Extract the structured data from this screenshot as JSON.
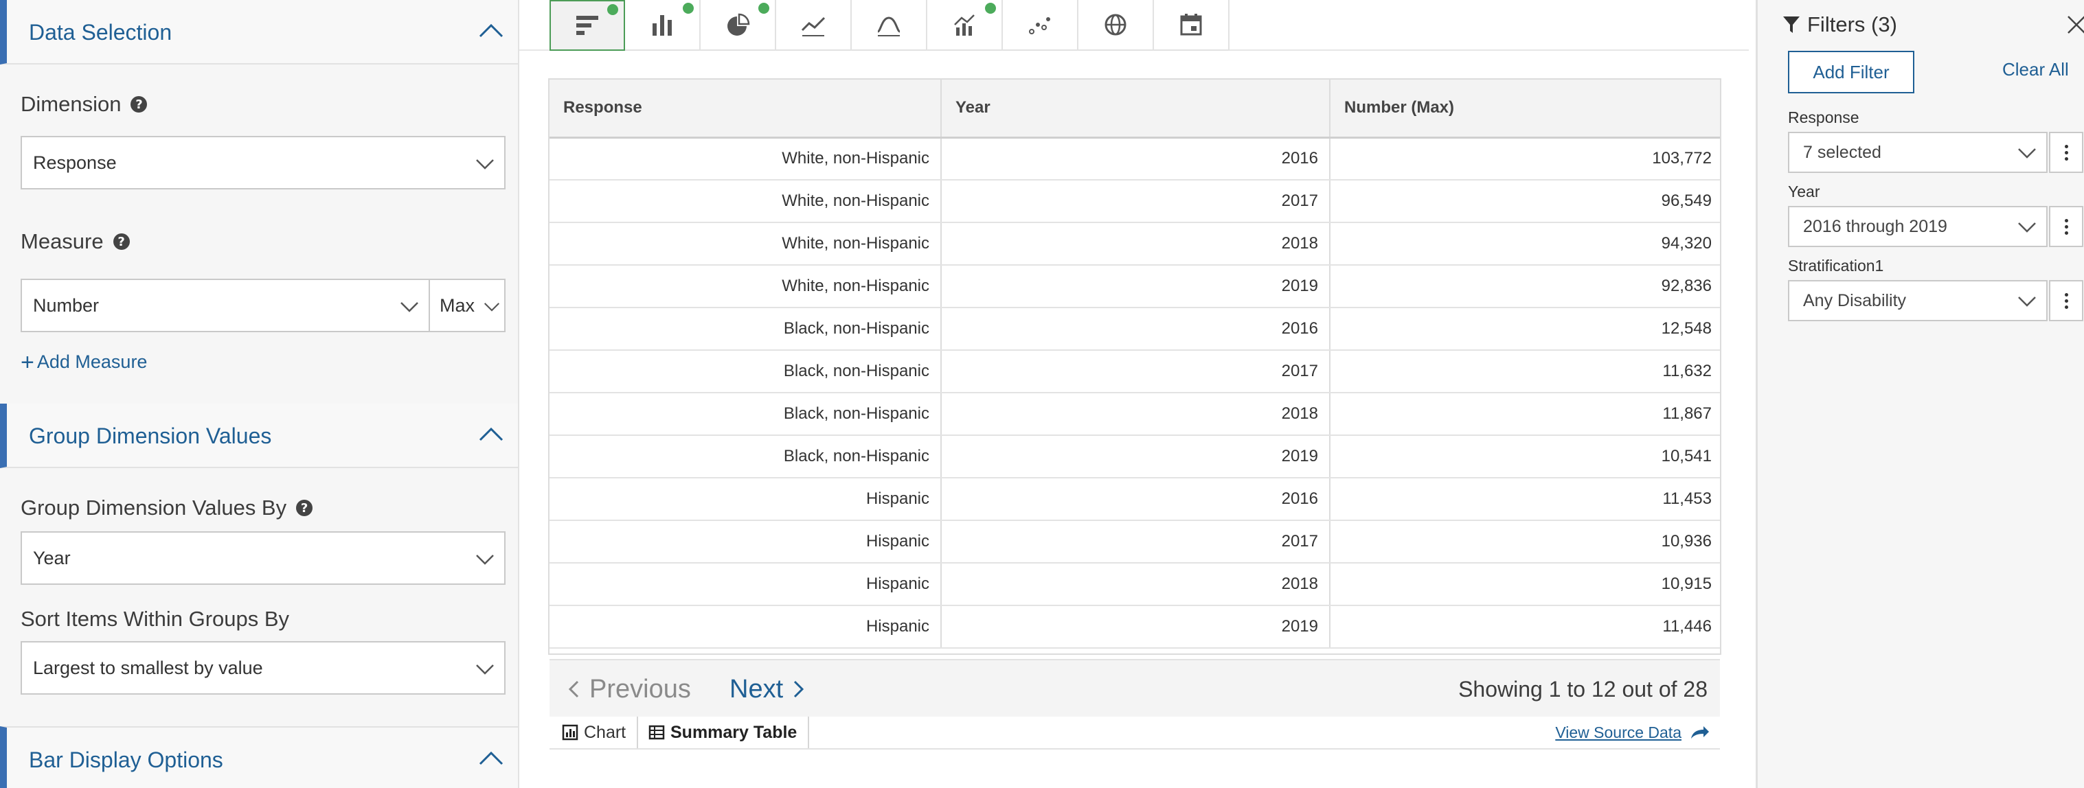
{
  "left_panel": {
    "data_selection": {
      "title": "Data Selection"
    },
    "dimension": {
      "label": "Dimension",
      "value": "Response"
    },
    "measure": {
      "label": "Measure",
      "value": "Number",
      "aggregate": "Max"
    },
    "add_measure": {
      "label": "Add Measure"
    },
    "group_dimension_values": {
      "title": "Group Dimension Values"
    },
    "group_by": {
      "label": "Group Dimension Values By",
      "value": "Year"
    },
    "sort_items": {
      "label": "Sort Items Within Groups By",
      "value": "Largest to smallest by value"
    },
    "bar_display_options": {
      "title": "Bar Display Options"
    }
  },
  "toolbar": {
    "buttons": [
      {
        "icon": "horizontal-bar-chart-icon",
        "active": true,
        "has_dot": true
      },
      {
        "icon": "vertical-bar-chart-icon",
        "active": false,
        "has_dot": true
      },
      {
        "icon": "pie-chart-icon",
        "active": false,
        "has_dot": true
      },
      {
        "icon": "line-chart-icon",
        "active": false,
        "has_dot": false
      },
      {
        "icon": "area-chart-icon",
        "active": false,
        "has_dot": false
      },
      {
        "icon": "combo-chart-icon",
        "active": false,
        "has_dot": true
      },
      {
        "icon": "scatter-chart-icon",
        "active": false,
        "has_dot": false
      },
      {
        "icon": "globe-map-icon",
        "active": false,
        "has_dot": false
      },
      {
        "icon": "calendar-icon",
        "active": false,
        "has_dot": false
      }
    ]
  },
  "table": {
    "columns": [
      "Response",
      "Year",
      "Number (Max)"
    ],
    "rows": [
      [
        "White, non-Hispanic",
        "2016",
        "103,772"
      ],
      [
        "White, non-Hispanic",
        "2017",
        "96,549"
      ],
      [
        "White, non-Hispanic",
        "2018",
        "94,320"
      ],
      [
        "White, non-Hispanic",
        "2019",
        "92,836"
      ],
      [
        "Black, non-Hispanic",
        "2016",
        "12,548"
      ],
      [
        "Black, non-Hispanic",
        "2017",
        "11,632"
      ],
      [
        "Black, non-Hispanic",
        "2018",
        "11,867"
      ],
      [
        "Black, non-Hispanic",
        "2019",
        "10,541"
      ],
      [
        "Hispanic",
        "2016",
        "11,453"
      ],
      [
        "Hispanic",
        "2017",
        "10,936"
      ],
      [
        "Hispanic",
        "2018",
        "10,915"
      ],
      [
        "Hispanic",
        "2019",
        "11,446"
      ]
    ]
  },
  "pager": {
    "previous": "Previous",
    "next": "Next",
    "showing": "Showing 1 to 12 out of 28"
  },
  "bottom_tabs": {
    "chart": "Chart",
    "summary_table": "Summary Table",
    "view_source": "View Source Data"
  },
  "filters": {
    "title": "Filters (3)",
    "add_filter": "Add Filter",
    "clear_all": "Clear All",
    "items": [
      {
        "label": "Response",
        "value": "7 selected"
      },
      {
        "label": "Year",
        "value": "2016 through 2019"
      },
      {
        "label": "Stratification1",
        "value": "Any Disability"
      }
    ]
  },
  "colors": {
    "accent_blue": "#1f5f94",
    "section_bar": "#3a6fb3",
    "status_green": "#4cab5b"
  }
}
